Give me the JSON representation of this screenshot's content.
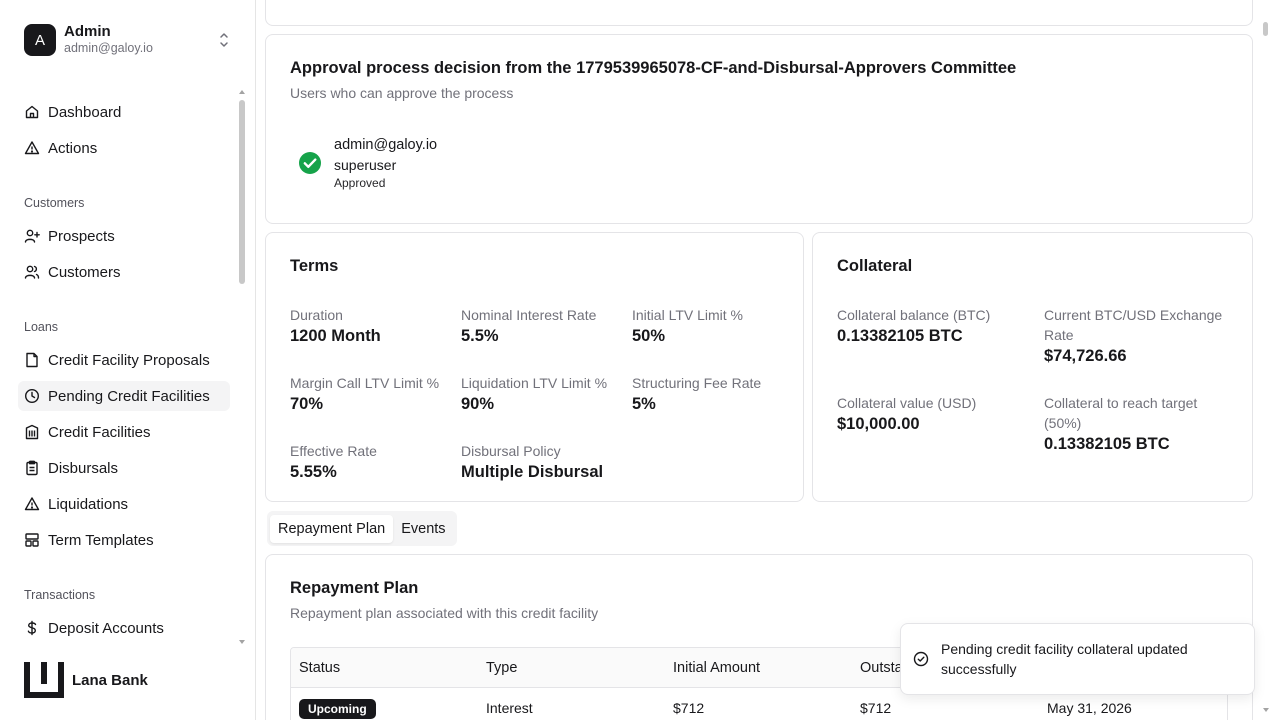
{
  "user": {
    "initial": "A",
    "name": "Admin",
    "email": "admin@galoy.io"
  },
  "nav": {
    "top": [
      {
        "label": "Dashboard",
        "icon": "home-icon"
      },
      {
        "label": "Actions",
        "icon": "warning-triangle-icon"
      }
    ],
    "sections": [
      {
        "title": "Customers",
        "items": [
          {
            "label": "Prospects",
            "icon": "user-plus-icon"
          },
          {
            "label": "Customers",
            "icon": "users-icon"
          }
        ]
      },
      {
        "title": "Loans",
        "items": [
          {
            "label": "Credit Facility Proposals",
            "icon": "file-icon"
          },
          {
            "label": "Pending Credit Facilities",
            "icon": "clock-icon",
            "active": true
          },
          {
            "label": "Credit Facilities",
            "icon": "building-icon"
          },
          {
            "label": "Disbursals",
            "icon": "clipboard-icon"
          },
          {
            "label": "Liquidations",
            "icon": "warning-triangle-icon"
          },
          {
            "label": "Term Templates",
            "icon": "layout-template-icon"
          }
        ]
      },
      {
        "title": "Transactions",
        "items": [
          {
            "label": "Deposit Accounts",
            "icon": "dollar-icon"
          }
        ]
      }
    ]
  },
  "brand": {
    "name": "Lana Bank"
  },
  "approval": {
    "title": "Approval process decision from the 1779539965078-CF-and-Disbursal-Approvers Committee",
    "subtitle": "Users who can approve the process",
    "approver": {
      "email": "admin@galoy.io",
      "role": "superuser",
      "status": "Approved"
    },
    "status_color": "#16a34a"
  },
  "terms": {
    "title": "Terms",
    "fields": [
      {
        "label": "Duration",
        "value": "1200 Month"
      },
      {
        "label": "Nominal Interest Rate",
        "value": "5.5%"
      },
      {
        "label": "Initial LTV Limit %",
        "value": "50%"
      },
      {
        "label": "Margin Call LTV Limit %",
        "value": "70%"
      },
      {
        "label": "Liquidation LTV Limit %",
        "value": "90%"
      },
      {
        "label": "Structuring Fee Rate",
        "value": "5%"
      },
      {
        "label": "Effective Rate",
        "value": "5.55%"
      },
      {
        "label": "Disbursal Policy",
        "value": "Multiple Disbursal"
      }
    ]
  },
  "collateral": {
    "title": "Collateral",
    "fields": [
      {
        "label": "Collateral balance (BTC)",
        "value": "0.13382105 BTC"
      },
      {
        "label": "Current BTC/USD Exchange Rate",
        "value": "$74,726.66"
      },
      {
        "label": "Collateral value (USD)",
        "value": "$10,000.00"
      },
      {
        "label": "Collateral to reach target (50%)",
        "value": "0.13382105 BTC"
      }
    ]
  },
  "tabs": [
    {
      "label": "Repayment Plan",
      "active": true
    },
    {
      "label": "Events",
      "active": false
    }
  ],
  "repayment": {
    "title": "Repayment Plan",
    "subtitle": "Repayment plan associated with this credit facility",
    "columns": [
      "Status",
      "Type",
      "Initial Amount",
      "Outsta",
      ""
    ],
    "rows": [
      {
        "status": "Upcoming",
        "type": "Interest",
        "initial": "$712",
        "outstanding": "$712",
        "due": "May 31, 2026"
      }
    ]
  },
  "toast": {
    "message": "Pending credit facility collateral updated successfully"
  }
}
